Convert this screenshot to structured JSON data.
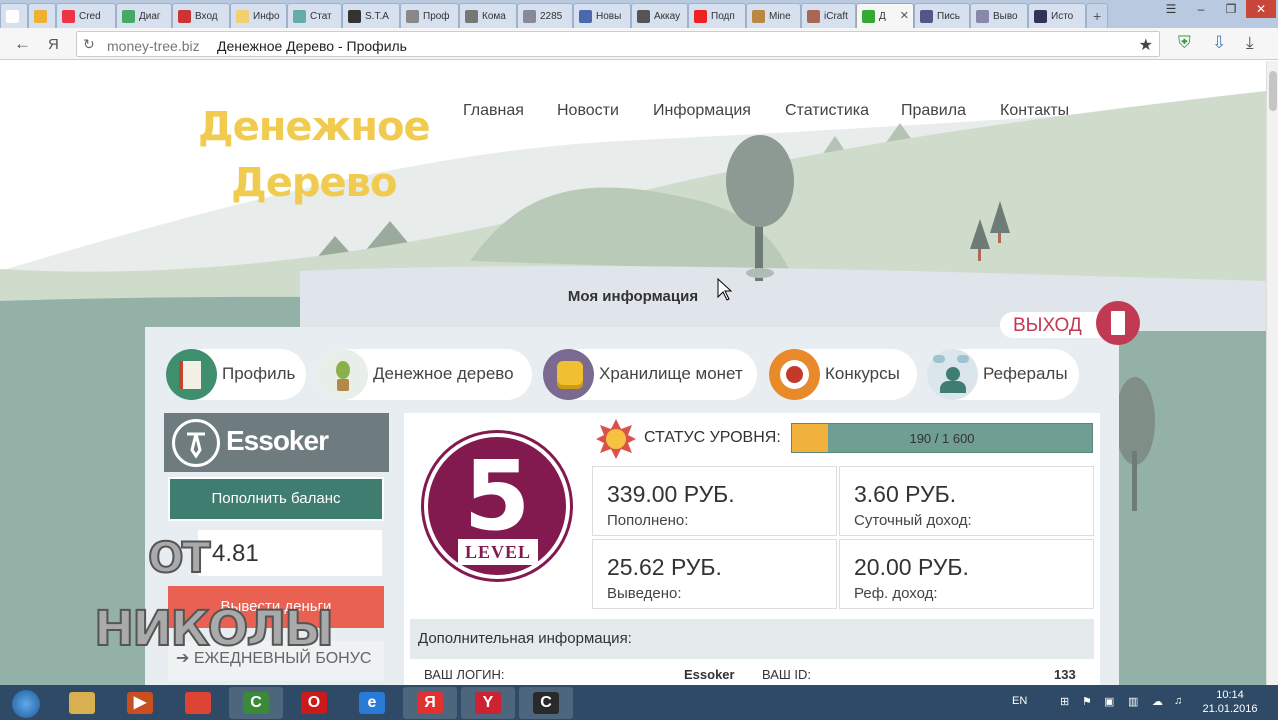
{
  "browser": {
    "tabs": [
      {
        "label": "",
        "icon": "page-icon",
        "color": "#ffffff"
      },
      {
        "label": "",
        "icon": "orange-icon",
        "color": "#f0b030"
      },
      {
        "label": "Cred",
        "icon": "clock-icon",
        "color": "#e34"
      },
      {
        "label": "Диаг",
        "icon": "chart-icon",
        "color": "#4a6"
      },
      {
        "label": "Вход",
        "icon": "gmail-icon",
        "color": "#c33"
      },
      {
        "label": "Инфо",
        "icon": "tree-icon",
        "color": "#f0d070"
      },
      {
        "label": "Стат",
        "icon": "stats-icon",
        "color": "#6aa"
      },
      {
        "label": "S.T.A",
        "icon": "radiation-icon",
        "color": "#333"
      },
      {
        "label": "Проф",
        "icon": "bird-icon",
        "color": "#888"
      },
      {
        "label": "Кома",
        "icon": "bird-icon",
        "color": "#777"
      },
      {
        "label": "2285",
        "icon": "window-icon",
        "color": "#889"
      },
      {
        "label": "Новы",
        "icon": "m-icon",
        "color": "#4a68b0"
      },
      {
        "label": "Аккау",
        "icon": "p-icon",
        "color": "#555"
      },
      {
        "label": "Подп",
        "icon": "youtube-icon",
        "color": "#e22"
      },
      {
        "label": "Mine",
        "icon": "mine-icon",
        "color": "#b84"
      },
      {
        "label": "iCraft",
        "icon": "craft-icon",
        "color": "#a65"
      },
      {
        "label": "Д",
        "icon": "tree-icon",
        "color": "#3a3"
      },
      {
        "label": "Пись",
        "icon": "mail-icon",
        "color": "#558"
      },
      {
        "label": "Выво",
        "icon": "bars-icon",
        "color": "#88a"
      },
      {
        "label": "Исто",
        "icon": "pb-icon",
        "color": "#335"
      }
    ],
    "url": "money-tree.biz",
    "page_title": "Денежное Дерево - Профиль",
    "yandex": "Я"
  },
  "site": {
    "logo_line1": "Денежное",
    "logo_line2": "Дерево",
    "menu": [
      "Главная",
      "Новости",
      "Информация",
      "Статистика",
      "Правила",
      "Контакты"
    ],
    "section_title": "Моя информация",
    "logout": "ВЫХОД"
  },
  "categories": [
    {
      "label": "Профиль",
      "icon": "profile-book-icon",
      "color": "#3f8f6f"
    },
    {
      "label": "Денежное дерево",
      "icon": "money-plant-icon",
      "color": "#e8eee8"
    },
    {
      "label": "Хранилище монет",
      "icon": "coin-stack-icon",
      "color": "#7a6a8f"
    },
    {
      "label": "Конкурсы",
      "icon": "target-icon",
      "color": "#e8892a"
    },
    {
      "label": "Рефералы",
      "icon": "referrals-icon",
      "color": "#dbe6ec"
    }
  ],
  "user": {
    "name": "Essoker",
    "topup_button": "Пополнить баланс",
    "balance": "4.81",
    "withdraw_button": "Вывести деньги",
    "daily_bonus": "ЕЖЕДНЕВНЫЙ БОНУС"
  },
  "level": {
    "number": "5",
    "word": "LEVEL",
    "status_label": "СТАТУС УРОВНЯ:",
    "progress_text": "190 / 1 600",
    "progress_fraction": 0.119
  },
  "stats": [
    {
      "value": "339.00 РУБ.",
      "label": "Пополнено:"
    },
    {
      "value": "3.60 РУБ.",
      "label": "Суточный доход:"
    },
    {
      "value": "25.62 РУБ.",
      "label": "Выведено:"
    },
    {
      "value": "20.00 РУБ.",
      "label": "Реф. доход:"
    }
  ],
  "extra": {
    "title": "Дополнительная информация:",
    "login_label": "ВАШ ЛОГИН:",
    "login_value": "Essoker",
    "id_label": "ВАШ ID:",
    "id_value": "133"
  },
  "overlay": {
    "line1": "ОТ",
    "line2": "НИКОЛЫ"
  },
  "taskbar": {
    "lang": "EN",
    "time": "10:14",
    "date": "21.01.2016",
    "apps": [
      {
        "name": "explorer",
        "glyph": "",
        "color": "#d8b050"
      },
      {
        "name": "media",
        "glyph": "▶",
        "color": "#c85020"
      },
      {
        "name": "chrome",
        "glyph": "",
        "color": "#dd4433"
      },
      {
        "name": "app-c1",
        "glyph": "C",
        "color": "#3a8a3a"
      },
      {
        "name": "opera",
        "glyph": "O",
        "color": "#cc1a1a"
      },
      {
        "name": "ie",
        "glyph": "e",
        "color": "#2a7ad8"
      },
      {
        "name": "yandex",
        "glyph": "Я",
        "color": "#e03030"
      },
      {
        "name": "yandex-browser",
        "glyph": "Y",
        "color": "#cc2233"
      },
      {
        "name": "app-c2",
        "glyph": "C",
        "color": "#2a2a2a"
      }
    ]
  }
}
